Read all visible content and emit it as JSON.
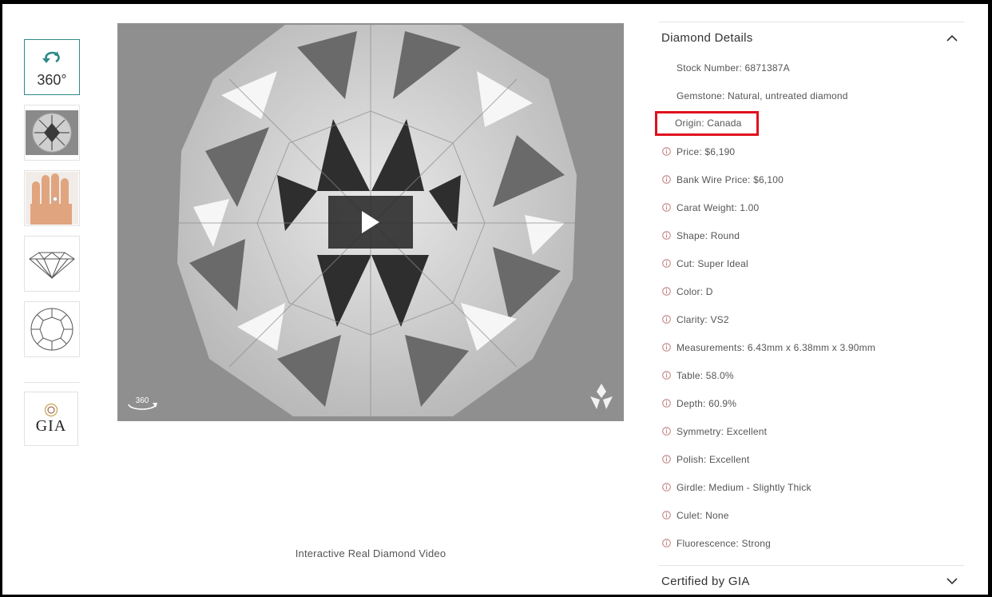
{
  "thumbnails": [
    {
      "name": "thumb-360",
      "label": "360°",
      "icon": "rotate-icon"
    },
    {
      "name": "thumb-diamond-top",
      "icon": "diamond-top-photo"
    },
    {
      "name": "thumb-hand",
      "icon": "hand-photo"
    },
    {
      "name": "thumb-diamond-side",
      "icon": "diamond-profile-icon"
    },
    {
      "name": "thumb-diamond-face",
      "icon": "diamond-face-icon"
    },
    {
      "name": "thumb-certificate",
      "label": "GIA",
      "icon": "certificate-icon"
    }
  ],
  "video": {
    "caption": "Interactive Real Diamond Video",
    "corner_badge": "360",
    "play_icon": "play-icon",
    "logo_icon": "brand-logo-icon"
  },
  "details": {
    "title": "Diamond Details",
    "rows": [
      {
        "text": "Stock Number: 6871387A",
        "info": false
      },
      {
        "text": "Gemstone: Natural, untreated diamond",
        "info": false
      },
      {
        "text": "Origin: Canada",
        "info": false,
        "highlighted": true
      },
      {
        "text": "Price: $6,190",
        "info": true
      },
      {
        "text": "Bank Wire Price: $6,100",
        "info": true
      },
      {
        "text": "Carat Weight: 1.00",
        "info": true
      },
      {
        "text": "Shape: Round",
        "info": true
      },
      {
        "text": "Cut: Super Ideal",
        "info": true
      },
      {
        "text": "Color: D",
        "info": true
      },
      {
        "text": "Clarity: VS2",
        "info": true
      },
      {
        "text": "Measurements: 6.43mm x 6.38mm x 3.90mm",
        "info": true
      },
      {
        "text": "Table: 58.0%",
        "info": true
      },
      {
        "text": "Depth: 60.9%",
        "info": true
      },
      {
        "text": "Symmetry: Excellent",
        "info": true
      },
      {
        "text": "Polish: Excellent",
        "info": true
      },
      {
        "text": "Girdle: Medium - Slightly Thick",
        "info": true
      },
      {
        "text": "Culet: None",
        "info": true
      },
      {
        "text": "Fluorescence: Strong",
        "info": true
      }
    ]
  },
  "certified": {
    "title": "Certified by GIA"
  },
  "colors": {
    "accent": "#2f8a86",
    "highlight": "#e0101e",
    "info_icon": "#c27b7b"
  }
}
